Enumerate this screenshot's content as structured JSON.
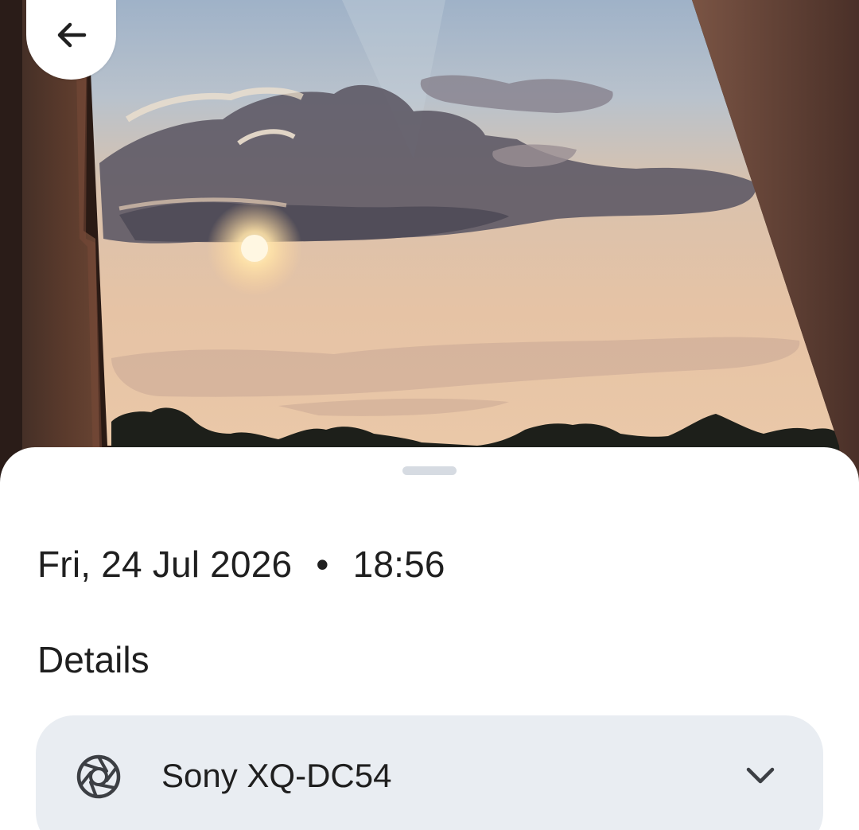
{
  "photo": {
    "description_icon": "sunset-photo"
  },
  "toolbar": {
    "back_icon": "arrow-left-icon"
  },
  "sheet": {
    "date": "Fri, 24 Jul 2026",
    "separator": "•",
    "time": "18:56",
    "details_title": "Details",
    "device": {
      "icon": "camera-aperture-icon",
      "name": "Sony XQ-DC54",
      "expand_icon": "chevron-down-icon"
    }
  },
  "colors": {
    "sheet_background": "#ffffff",
    "card_background": "#e9edf2",
    "text_primary": "#1f1f1f",
    "handle": "#d6dbe2"
  }
}
